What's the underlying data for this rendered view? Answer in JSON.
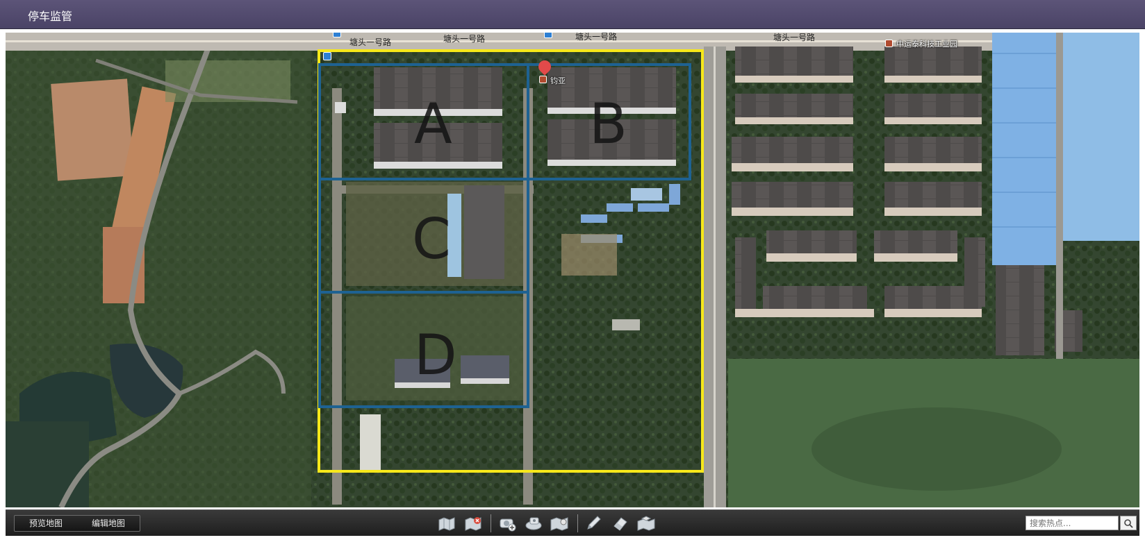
{
  "app": {
    "title": "停车监管"
  },
  "map": {
    "roads": [
      "塘头一号路",
      "塘头一号路",
      "塘头一号路",
      "塘头一号路"
    ],
    "poi": [
      {
        "label": "中运泰科技工业园",
        "icon": "poi-marker-icon"
      },
      {
        "label": "钧亚",
        "icon": "location-pin-icon"
      }
    ],
    "zones": [
      {
        "id": "A",
        "label": "A"
      },
      {
        "id": "B",
        "label": "B"
      },
      {
        "id": "C",
        "label": "C"
      },
      {
        "id": "D",
        "label": "D"
      }
    ],
    "colors": {
      "boundary": "#f7e81a",
      "zone_border": "#1e6292"
    }
  },
  "toolbar": {
    "tabs": [
      {
        "label": "预览地图"
      },
      {
        "label": "编辑地图"
      }
    ],
    "tools": [
      {
        "icon": "map-view-icon"
      },
      {
        "icon": "map-close-icon"
      },
      {
        "icon": "add-camera-icon"
      },
      {
        "icon": "camera-map-icon"
      },
      {
        "icon": "map-link-icon"
      },
      {
        "icon": "pencil-icon"
      },
      {
        "icon": "eraser-icon"
      },
      {
        "icon": "map-layers-icon"
      }
    ],
    "search": {
      "placeholder": "搜索热点..."
    }
  }
}
